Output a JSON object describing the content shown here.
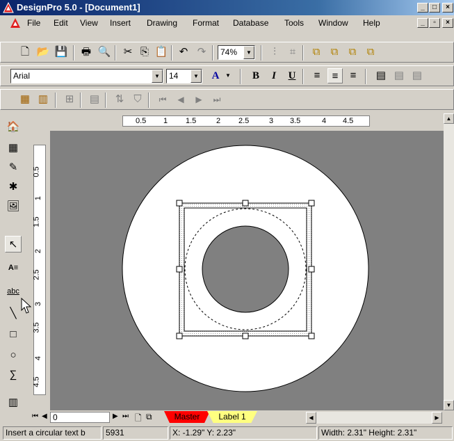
{
  "window": {
    "title": "DesignPro 5.0 - [Document1]",
    "min": "_",
    "max": "□",
    "close": "×",
    "doc_min": "_",
    "doc_restore": "▫",
    "doc_close": "×"
  },
  "menu": [
    "File",
    "Edit",
    "View",
    "Insert",
    "Drawing",
    "Format",
    "Database",
    "Tools",
    "Window",
    "Help"
  ],
  "toolbar": {
    "zoom_value": "74%"
  },
  "format_bar": {
    "font_name": "Arial",
    "font_size": "14",
    "font_color_label": "A",
    "bold": "B",
    "italic": "I",
    "underline": "U"
  },
  "ruler": {
    "h_labels": [
      "0.5",
      "1",
      "1.5",
      "2",
      "2.5",
      "3",
      "3.5",
      "4",
      "4.5"
    ],
    "v_labels": [
      "0.5",
      "1",
      "1.5",
      "2",
      "2.5",
      "3",
      "3.5",
      "4",
      "4.5"
    ]
  },
  "tabs": {
    "page_input": "0",
    "master": "Master",
    "label1": "Label 1"
  },
  "status": {
    "message": "Insert a circular text b",
    "code": "5931",
    "position": "X: -1.29\"  Y: 2.23\"",
    "size": "Width: 2.31\"  Height: 2.31\""
  },
  "icons": {
    "new": "new-document-icon",
    "open": "open-folder-icon",
    "save": "save-icon",
    "print": "print-icon",
    "preview": "print-preview-icon",
    "cut": "cut-icon",
    "copy": "copy-icon",
    "paste": "paste-icon",
    "undo": "undo-icon",
    "redo": "redo-icon"
  },
  "colors": {
    "master_tab": "#ff0000",
    "label_tab": "#ffff80",
    "canvas_bg": "#808080",
    "title_bar": "#0a246a"
  }
}
